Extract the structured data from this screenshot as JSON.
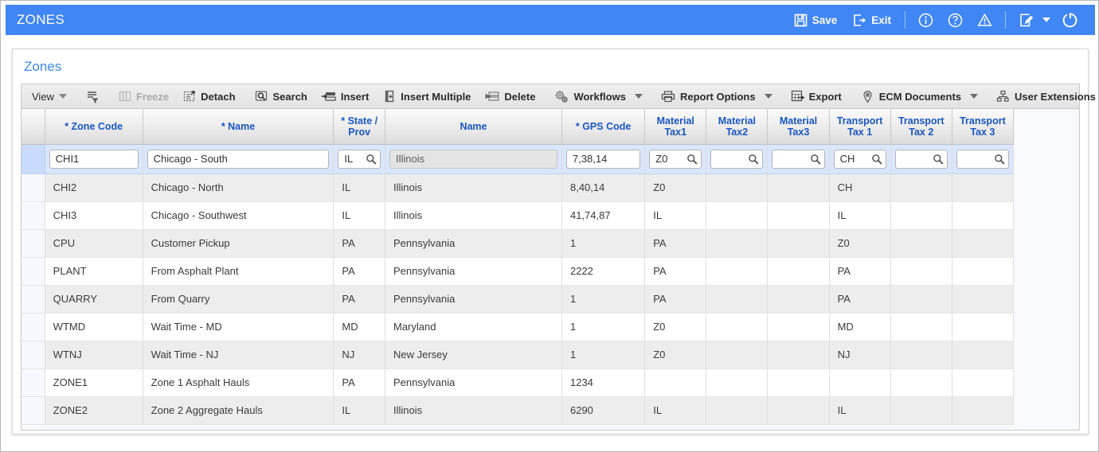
{
  "window": {
    "title": "ZONES",
    "accent_color": "#4086f4",
    "toolbar": [
      {
        "name": "save-button",
        "label": "Save",
        "icon": "floppy-disk-icon"
      },
      {
        "name": "exit-button",
        "label": "Exit",
        "icon": "exit-door-icon"
      },
      {
        "name": "info-button",
        "label": "",
        "icon": "info-circle-icon"
      },
      {
        "name": "help-button",
        "label": "",
        "icon": "question-circle-icon"
      },
      {
        "name": "warning-button",
        "label": "",
        "icon": "warning-triangle-icon"
      },
      {
        "name": "notes-button",
        "label": "",
        "icon": "edit-note-icon"
      },
      {
        "name": "refresh-button",
        "label": "",
        "icon": "refresh-icon"
      }
    ]
  },
  "panel": {
    "title": "Zones"
  },
  "gridbar": {
    "items": [
      {
        "name": "view-menu",
        "label": "View",
        "icon": "",
        "caret": true,
        "disabled": false,
        "bold": false
      },
      {
        "name": "query-by-example",
        "label": "",
        "icon": "query-filter-icon",
        "caret": false,
        "disabled": false,
        "bold": false
      },
      {
        "name": "freeze-button",
        "label": "Freeze",
        "icon": "freeze-columns-icon",
        "caret": false,
        "disabled": true,
        "bold": true
      },
      {
        "name": "detach-button",
        "label": "Detach",
        "icon": "detach-icon",
        "caret": false,
        "disabled": false,
        "bold": true
      },
      {
        "name": "search-button",
        "label": "Search",
        "icon": "search-icon",
        "caret": false,
        "disabled": false,
        "bold": true
      },
      {
        "name": "insert-button",
        "label": "Insert",
        "icon": "insert-row-icon",
        "caret": false,
        "disabled": false,
        "bold": true
      },
      {
        "name": "insert-multiple-button",
        "label": "Insert Multiple",
        "icon": "insert-multiple-icon",
        "caret": false,
        "disabled": false,
        "bold": true
      },
      {
        "name": "delete-button",
        "label": "Delete",
        "icon": "delete-row-icon",
        "caret": false,
        "disabled": false,
        "bold": true
      },
      {
        "name": "workflows-menu",
        "label": "Workflows",
        "icon": "gears-icon",
        "caret": true,
        "disabled": false,
        "bold": true
      },
      {
        "name": "report-options-menu",
        "label": "Report Options",
        "icon": "printer-icon",
        "caret": true,
        "disabled": false,
        "bold": true
      },
      {
        "name": "export-button",
        "label": "Export",
        "icon": "export-grid-icon",
        "caret": false,
        "disabled": false,
        "bold": true
      },
      {
        "name": "ecm-documents-menu",
        "label": "ECM Documents",
        "icon": "document-pin-icon",
        "caret": true,
        "disabled": false,
        "bold": true
      },
      {
        "name": "user-extensions-button",
        "label": "User Extensions",
        "icon": "hierarchy-icon",
        "caret": false,
        "disabled": false,
        "bold": true
      }
    ]
  },
  "table": {
    "columns": [
      {
        "key": "code",
        "label": "* Zone Code",
        "required": true
      },
      {
        "key": "name",
        "label": "* Name",
        "required": true
      },
      {
        "key": "state",
        "label": "* State /\nProv",
        "required": true
      },
      {
        "key": "stname",
        "label": "Name",
        "required": false
      },
      {
        "key": "gps",
        "label": "* GPS Code",
        "required": true
      },
      {
        "key": "mtax1",
        "label": "Material\nTax1",
        "required": false
      },
      {
        "key": "mtax2",
        "label": "Material\nTax2",
        "required": false
      },
      {
        "key": "mtax3",
        "label": "Material\nTax3",
        "required": false
      },
      {
        "key": "ttax1",
        "label": "Transport\nTax 1",
        "required": false
      },
      {
        "key": "ttax2",
        "label": "Transport\nTax 2",
        "required": false
      },
      {
        "key": "ttax3",
        "label": "Transport\nTax 3",
        "required": false
      }
    ],
    "edit_row": {
      "selected": true,
      "fields": {
        "code": {
          "value": "CHI1",
          "lov": false,
          "readonly": false
        },
        "name": {
          "value": "Chicago - South",
          "lov": false,
          "readonly": false
        },
        "state": {
          "value": "IL",
          "lov": true,
          "readonly": false
        },
        "stname": {
          "value": "Illinois",
          "lov": false,
          "readonly": true
        },
        "gps": {
          "value": "7,38,14",
          "lov": false,
          "readonly": false
        },
        "mtax1": {
          "value": "Z0",
          "lov": true,
          "readonly": false
        },
        "mtax2": {
          "value": "",
          "lov": true,
          "readonly": false
        },
        "mtax3": {
          "value": "",
          "lov": true,
          "readonly": false
        },
        "ttax1": {
          "value": "CH",
          "lov": true,
          "readonly": false
        },
        "ttax2": {
          "value": "",
          "lov": true,
          "readonly": false
        },
        "ttax3": {
          "value": "",
          "lov": true,
          "readonly": false
        }
      }
    },
    "rows": [
      {
        "code": "CHI2",
        "name": "Chicago - North",
        "state": "IL",
        "stname": "Illinois",
        "gps": "8,40,14",
        "mtax1": "Z0",
        "mtax2": "",
        "mtax3": "",
        "ttax1": "CH",
        "ttax2": "",
        "ttax3": ""
      },
      {
        "code": "CHI3",
        "name": "Chicago - Southwest",
        "state": "IL",
        "stname": "Illinois",
        "gps": "41,74,87",
        "mtax1": "IL",
        "mtax2": "",
        "mtax3": "",
        "ttax1": "IL",
        "ttax2": "",
        "ttax3": ""
      },
      {
        "code": "CPU",
        "name": "Customer Pickup",
        "state": "PA",
        "stname": "Pennsylvania",
        "gps": "1",
        "mtax1": "PA",
        "mtax2": "",
        "mtax3": "",
        "ttax1": "Z0",
        "ttax2": "",
        "ttax3": ""
      },
      {
        "code": "PLANT",
        "name": "From Asphalt Plant",
        "state": "PA",
        "stname": "Pennsylvania",
        "gps": "2222",
        "mtax1": "PA",
        "mtax2": "",
        "mtax3": "",
        "ttax1": "PA",
        "ttax2": "",
        "ttax3": ""
      },
      {
        "code": "QUARRY",
        "name": "From Quarry",
        "state": "PA",
        "stname": "Pennsylvania",
        "gps": "1",
        "mtax1": "PA",
        "mtax2": "",
        "mtax3": "",
        "ttax1": "PA",
        "ttax2": "",
        "ttax3": ""
      },
      {
        "code": "WTMD",
        "name": "Wait Time - MD",
        "state": "MD",
        "stname": "Maryland",
        "gps": "1",
        "mtax1": "Z0",
        "mtax2": "",
        "mtax3": "",
        "ttax1": "MD",
        "ttax2": "",
        "ttax3": ""
      },
      {
        "code": "WTNJ",
        "name": "Wait Time - NJ",
        "state": "NJ",
        "stname": "New Jersey",
        "gps": "1",
        "mtax1": "Z0",
        "mtax2": "",
        "mtax3": "",
        "ttax1": "NJ",
        "ttax2": "",
        "ttax3": ""
      },
      {
        "code": "ZONE1",
        "name": "Zone 1 Asphalt Hauls",
        "state": "PA",
        "stname": "Pennsylvania",
        "gps": "1234",
        "mtax1": "",
        "mtax2": "",
        "mtax3": "",
        "ttax1": "",
        "ttax2": "",
        "ttax3": ""
      },
      {
        "code": "ZONE2",
        "name": "Zone 2 Aggregate Hauls",
        "state": "IL",
        "stname": "Illinois",
        "gps": "6290",
        "mtax1": "IL",
        "mtax2": "",
        "mtax3": "",
        "ttax1": "IL",
        "ttax2": "",
        "ttax3": ""
      }
    ]
  }
}
